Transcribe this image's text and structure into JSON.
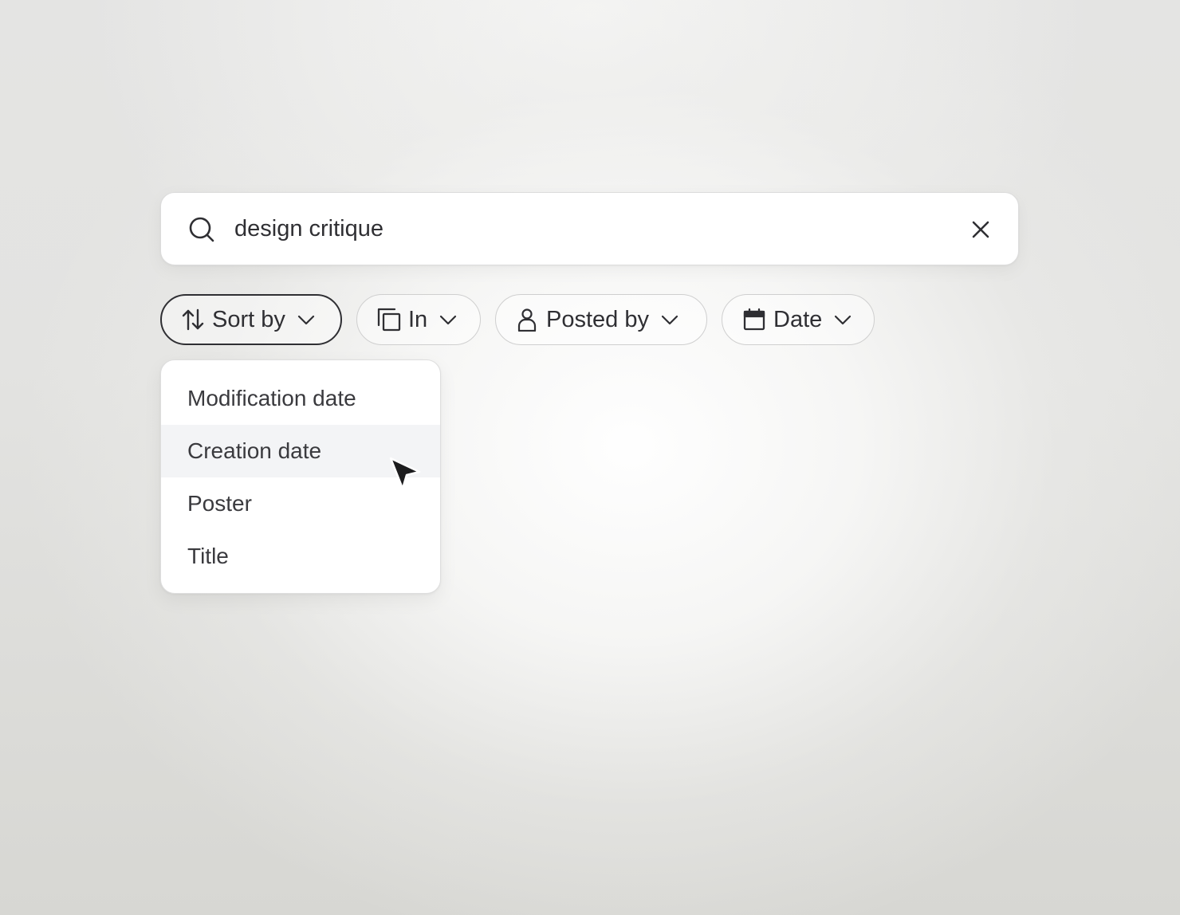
{
  "search": {
    "value": "design critique",
    "placeholder": "",
    "search_icon": "search-icon",
    "clear_icon": "close-icon"
  },
  "filters": [
    {
      "id": "sort",
      "label": "Sort by",
      "icon": "sort-arrows-icon",
      "active": true
    },
    {
      "id": "in",
      "label": "In",
      "icon": "copy-icon",
      "active": false
    },
    {
      "id": "posted",
      "label": "Posted by",
      "icon": "person-icon",
      "active": false
    },
    {
      "id": "date",
      "label": "Date",
      "icon": "calendar-icon",
      "active": false
    }
  ],
  "sort_menu": {
    "items": [
      {
        "label": "Modification date",
        "hovered": false
      },
      {
        "label": "Creation date",
        "hovered": true
      },
      {
        "label": "Poster",
        "hovered": false
      },
      {
        "label": "Title",
        "hovered": false
      }
    ]
  },
  "colors": {
    "text": "#2f2f33",
    "chip_border": "#cfcfcf",
    "active_chip_border": "#2f2f33",
    "hover_bg": "#f3f4f6"
  }
}
